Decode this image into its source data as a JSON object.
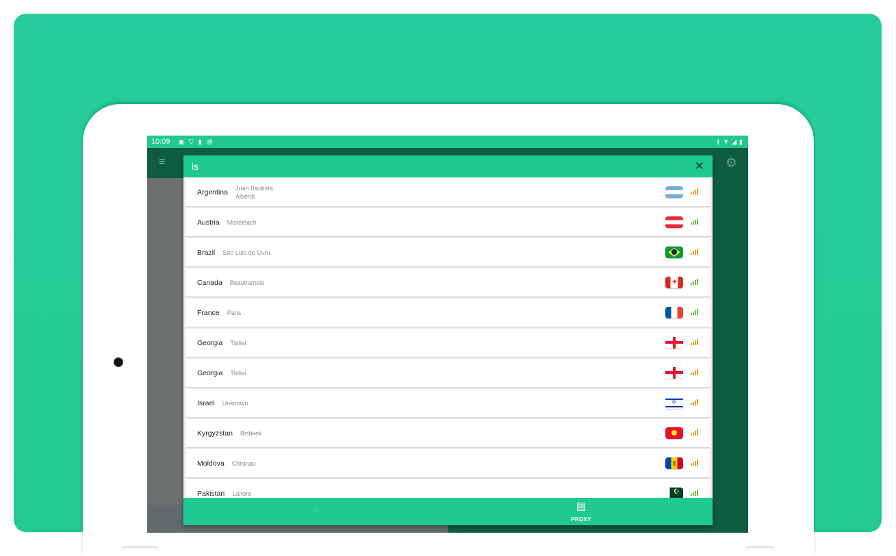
{
  "status_bar": {
    "time": "10:09",
    "left_icons": [
      "a-icon",
      "shield-icon",
      "sd-card-icon",
      "at-icon"
    ],
    "right_icons": [
      "vpn-key-icon",
      "wifi-icon",
      "signal-icon",
      "battery-icon"
    ]
  },
  "colors": {
    "primary": "#21c992",
    "dark_green": "#0e5c43",
    "signal_orange": "#f0a020",
    "signal_green": "#6cc04a"
  },
  "search": {
    "value": "is",
    "close_icon": "close-icon"
  },
  "servers": [
    {
      "country": "Argentina",
      "city": "Juan Bautista Alberdi",
      "flag": "argentina",
      "signal": "orange"
    },
    {
      "country": "Austria",
      "city": "Mistelbach",
      "flag": "austria",
      "signal": "green"
    },
    {
      "country": "Brazil",
      "city": "Sao Luis do Curu",
      "flag": "brazil",
      "signal": "orange"
    },
    {
      "country": "Canada",
      "city": "Beauharnois",
      "flag": "canada",
      "signal": "green"
    },
    {
      "country": "France",
      "city": "Paris",
      "flag": "france",
      "signal": "green"
    },
    {
      "country": "Georgia",
      "city": "Tbilisi",
      "flag": "georgia",
      "signal": "orange"
    },
    {
      "country": "Georgia",
      "city": "Tbilisi",
      "flag": "georgia",
      "signal": "orange"
    },
    {
      "country": "Israel",
      "city": "Unknown",
      "flag": "israel",
      "signal": "orange"
    },
    {
      "country": "Kyrgyzstan",
      "city": "Bishkek",
      "flag": "kyrgyzstan",
      "signal": "orange"
    },
    {
      "country": "Moldova",
      "city": "Chisinau",
      "flag": "moldova",
      "signal": "orange"
    },
    {
      "country": "Pakistan",
      "city": "Lahore",
      "flag": "pakistan",
      "signal": "green"
    }
  ],
  "bottom_nav": {
    "vpn_icon": "vpn-icon",
    "proxy_icon": "proxy-server-icon",
    "proxy_label": "PROXY"
  },
  "app_bar": {
    "menu_icon": "menu-icon",
    "settings_icon": "gear-icon"
  }
}
